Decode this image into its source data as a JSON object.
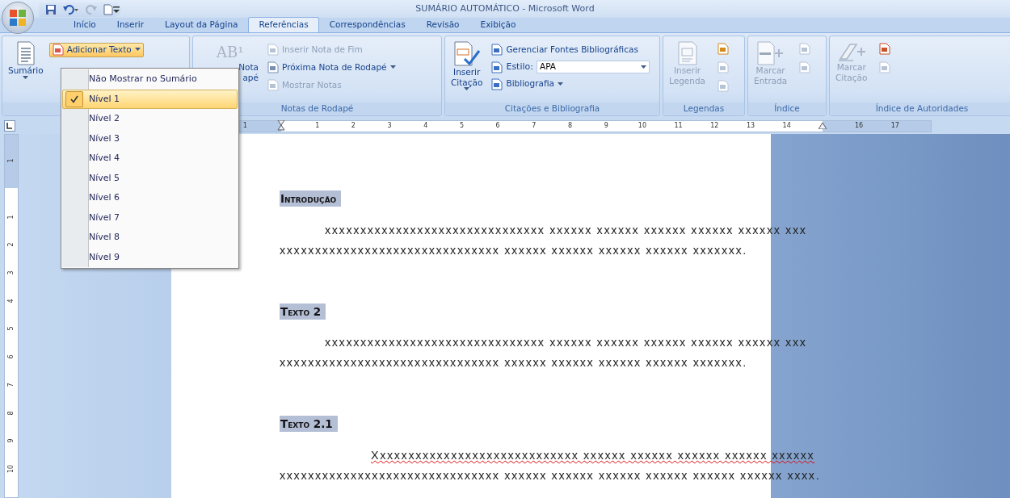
{
  "window": {
    "title": "SUMÁRIO AUTOMÁTICO - Microsoft Word"
  },
  "quick_access": [
    {
      "kind": "save",
      "disabled": false
    },
    {
      "kind": "undo",
      "disabled": false
    },
    {
      "kind": "redo",
      "disabled": true
    },
    {
      "kind": "new",
      "disabled": false
    }
  ],
  "tabs": [
    {
      "label": "Início",
      "selected": false
    },
    {
      "label": "Inserir",
      "selected": false
    },
    {
      "label": "Layout da Página",
      "selected": false
    },
    {
      "label": "Referências",
      "selected": true
    },
    {
      "label": "Correspondências",
      "selected": false
    },
    {
      "label": "Revisão",
      "selected": false
    },
    {
      "label": "Exibição",
      "selected": false
    }
  ],
  "ribbon": {
    "groups": [
      {
        "controls": [
          {
            "kind": "large",
            "lines": [
              "Sumário"
            ],
            "caret": true,
            "disabled": false,
            "expanded": false
          },
          {
            "kind": "small",
            "label": "Adicionar Texto",
            "caret": true,
            "disabled": false,
            "expanded": true
          }
        ]
      },
      {
        "label": "Notas de Rodapé",
        "controls": [
          {
            "kind": "large",
            "icon_text": "AB¹",
            "lines": [
              "Nota",
              "apé"
            ],
            "caret": false,
            "disabled": false,
            "expanded": false
          },
          {
            "kind": "small",
            "label": "Inserir Nota de Fim",
            "caret": false,
            "disabled": true,
            "expanded": false
          },
          {
            "kind": "small",
            "label": "Próxima Nota de Rodapé",
            "caret": true,
            "disabled": false,
            "expanded": false
          },
          {
            "kind": "small",
            "label": "Mostrar Notas",
            "caret": false,
            "disabled": true,
            "expanded": false
          }
        ]
      },
      {
        "label": "Citações e Bibliografia",
        "controls": [
          {
            "kind": "large",
            "lines": [
              "Inserir",
              "Citação"
            ],
            "caret": true,
            "disabled": false,
            "expanded": false
          },
          {
            "kind": "small",
            "label": "Gerenciar Fontes Bibliográficas",
            "caret": false,
            "disabled": false,
            "expanded": false
          },
          {
            "kind": "combo",
            "label": "Estilo:",
            "value": "APA",
            "caret": true,
            "disabled": false,
            "expanded": false
          },
          {
            "kind": "small",
            "label": "Bibliografia",
            "caret": true,
            "disabled": false,
            "expanded": false
          }
        ]
      },
      {
        "label": "Legendas",
        "controls": [
          {
            "kind": "large",
            "lines": [
              "Inserir",
              "Legenda"
            ],
            "caret": false,
            "disabled": true,
            "expanded": false
          },
          {
            "kind": "icon",
            "caret": false,
            "disabled": false,
            "expanded": false
          },
          {
            "kind": "icon",
            "caret": false,
            "disabled": true,
            "expanded": false
          },
          {
            "kind": "icon",
            "caret": false,
            "disabled": true,
            "expanded": false
          }
        ]
      },
      {
        "label": "Índice",
        "controls": [
          {
            "kind": "large",
            "lines": [
              "Marcar",
              "Entrada"
            ],
            "caret": false,
            "disabled": true,
            "expanded": false
          },
          {
            "kind": "icon",
            "caret": false,
            "disabled": true,
            "expanded": false
          },
          {
            "kind": "icon",
            "caret": false,
            "disabled": true,
            "expanded": false
          }
        ]
      },
      {
        "label": "Índice de Autoridades",
        "controls": [
          {
            "kind": "large",
            "lines": [
              "Marcar",
              "Citação"
            ],
            "caret": false,
            "disabled": true,
            "expanded": false
          },
          {
            "kind": "icon",
            "caret": false,
            "disabled": false,
            "expanded": false
          },
          {
            "kind": "icon",
            "caret": false,
            "disabled": true,
            "expanded": false
          }
        ]
      }
    ]
  },
  "dropdown_menu": {
    "items": [
      {
        "label": "Não Mostrar no Sumário",
        "selected": false
      },
      {
        "label": "Nível 1",
        "selected": true
      },
      {
        "label": "Nível 2",
        "selected": false
      },
      {
        "label": "Nível 3",
        "selected": false
      },
      {
        "label": "Nível 4",
        "selected": false
      },
      {
        "label": "Nível 5",
        "selected": false
      },
      {
        "label": "Nível 6",
        "selected": false
      },
      {
        "label": "Nível 7",
        "selected": false
      },
      {
        "label": "Nível 8",
        "selected": false
      },
      {
        "label": "Nível 9",
        "selected": false
      }
    ]
  },
  "rulers": {
    "horizontal": [
      "1",
      "1",
      "2",
      "3",
      "4",
      "5",
      "6",
      "7",
      "8",
      "9",
      "10",
      "11",
      "12",
      "13",
      "14",
      "16",
      "17"
    ],
    "vertical": [
      "1",
      "1",
      "2",
      "3",
      "4",
      "5",
      "6",
      "7",
      "8",
      "9",
      "10"
    ]
  },
  "document": {
    "sections": [
      {
        "heading": "Introdução",
        "paragraph": {
          "kind": "indent",
          "misspelled": false,
          "lines": [
            "xxxxxxxxxxxxxxxxxxxxxxxxxxxxxxx xxxxxx xxxxxx xxxxxx xxxxxx xxxxxx xxx",
            "xxxxxxxxxxxxxxxxxxxxxxxxxxxxxxx xxxxxx xxxxxx xxxxxx xxxxxx xxxxxxx."
          ]
        }
      },
      {
        "heading": "Texto 2",
        "paragraph": {
          "kind": "indent",
          "misspelled": false,
          "lines": [
            "xxxxxxxxxxxxxxxxxxxxxxxxxxxxxxx xxxxxx xxxxxx xxxxxx xxxxxx xxxxxx xxx",
            "xxxxxxxxxxxxxxxxxxxxxxxxxxxxxxx xxxxxx xxxxxx xxxxxx xxxxxx xxxxxxx."
          ]
        }
      },
      {
        "heading": "Texto 2.1",
        "paragraph": {
          "kind": "double_indent",
          "misspelled": true,
          "lines": [
            "Xxxxxxxxxxxxxxxxxxxxxxxxxxxxx xxxxxx xxxxxx xxxxxx xxxxxx xxxxxx",
            "xxxxxxxxxxxxxxxxxxxxxxxxxxxxxxx xxxxxx xxxxxx xxxxxx xxxxxx xxxxxx xxxxxx xxxx."
          ]
        }
      }
    ]
  }
}
